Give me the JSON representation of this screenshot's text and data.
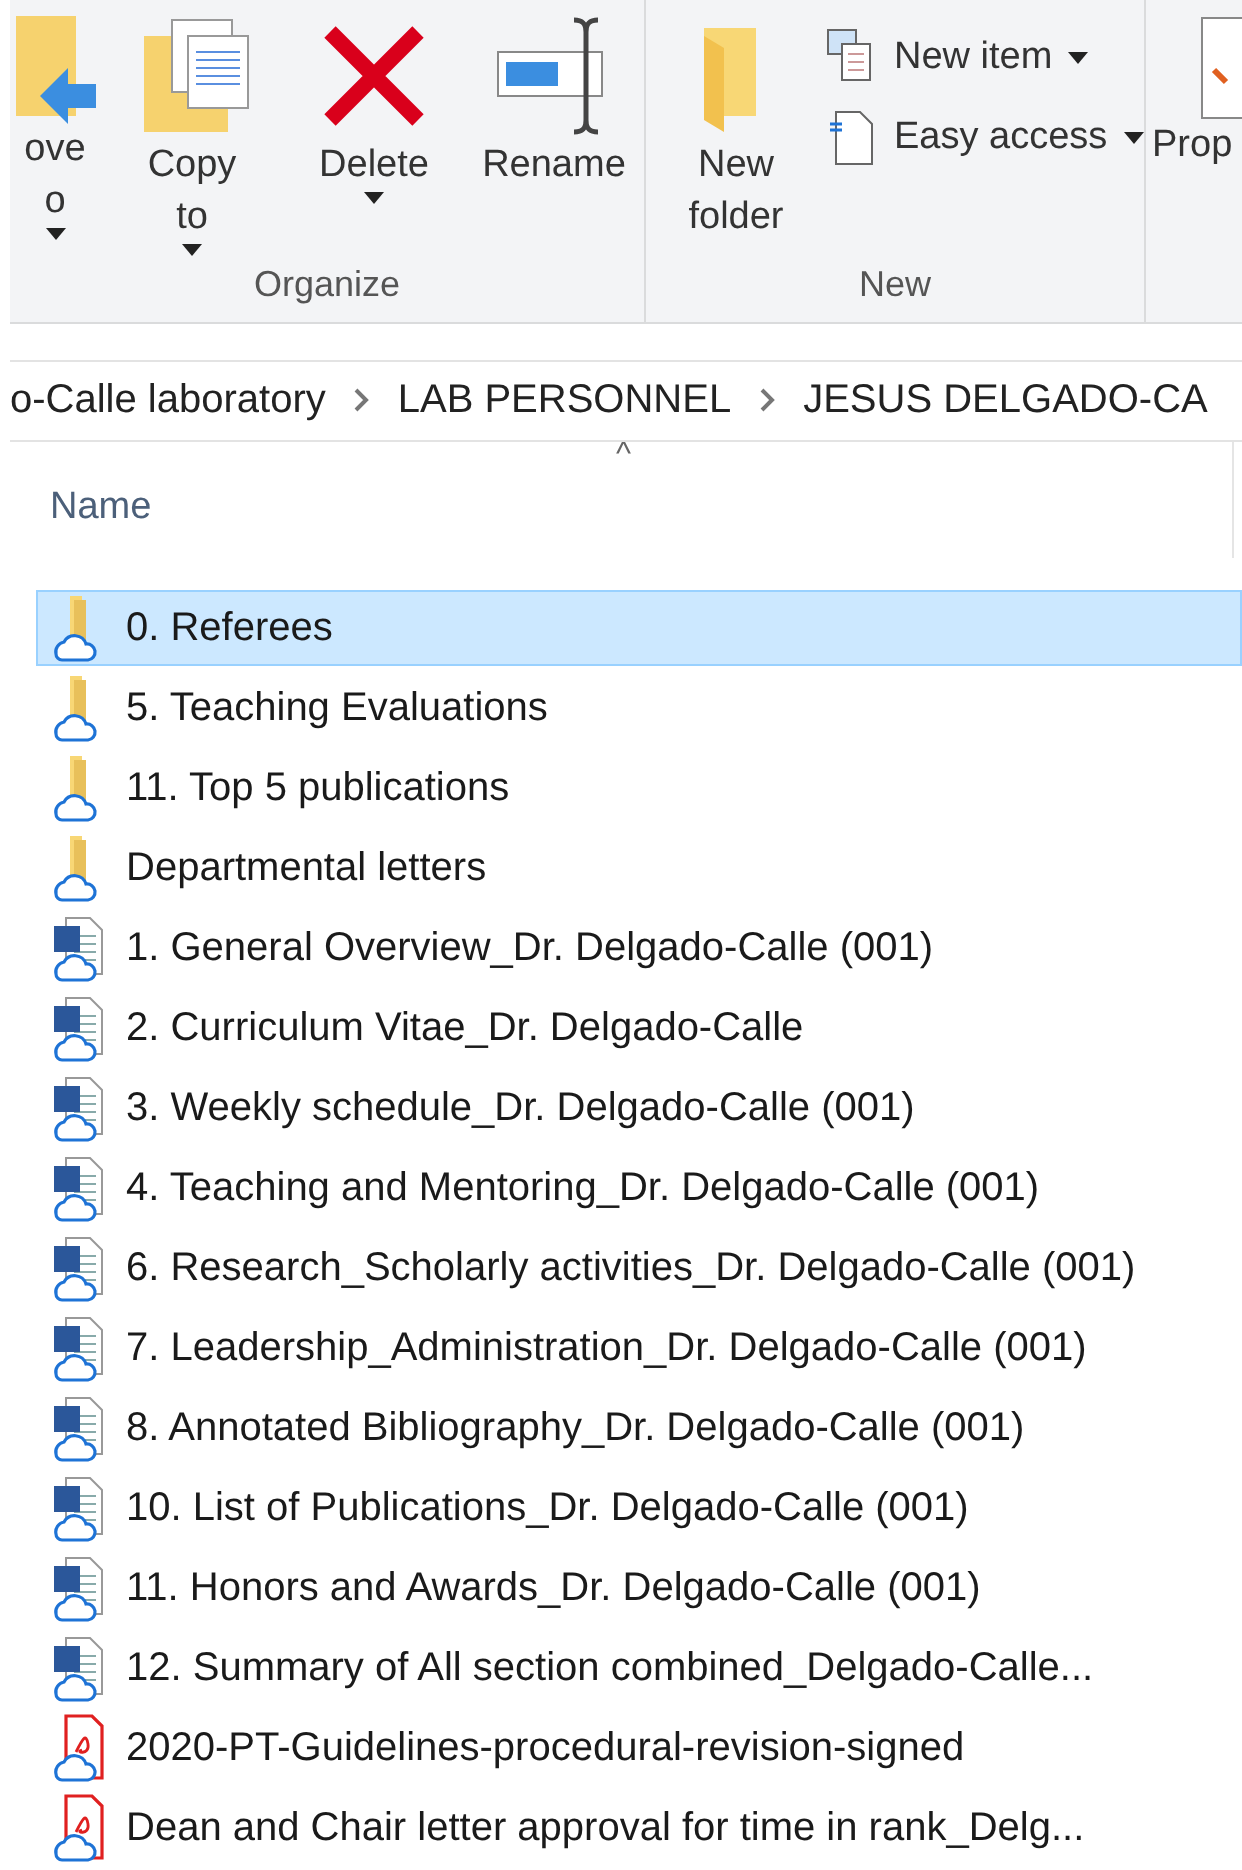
{
  "ribbon": {
    "groups": [
      {
        "label": "Organize",
        "buttons": [
          {
            "kind": "move",
            "lines": [
              "ove",
              "o"
            ],
            "caret": true
          },
          {
            "kind": "copy",
            "lines": [
              "Copy",
              "to"
            ],
            "caret": true
          },
          {
            "kind": "delete",
            "lines": [
              "Delete"
            ],
            "caret": true
          },
          {
            "kind": "rename",
            "lines": [
              "Rename"
            ],
            "caret": false
          }
        ]
      },
      {
        "label": "New",
        "buttons": [
          {
            "kind": "newfolder",
            "lines": [
              "New",
              "folder"
            ],
            "caret": false
          }
        ],
        "small": [
          {
            "kind": "newitem",
            "label": "New item",
            "caret": true
          },
          {
            "kind": "easyaccess",
            "label": "Easy access",
            "caret": true
          }
        ]
      },
      {
        "buttons": [
          {
            "kind": "properties",
            "lines": [
              "Prop"
            ],
            "caret": false
          }
        ]
      }
    ]
  },
  "breadcrumb": [
    "o-Calle laboratory",
    "LAB PERSONNEL",
    "JESUS DELGADO-CA"
  ],
  "header": {
    "name": "Name",
    "sort_glyph": "^"
  },
  "files": [
    {
      "kind": "folder",
      "name": "0. Referees",
      "selected": true
    },
    {
      "kind": "folder",
      "name": "5. Teaching Evaluations",
      "selected": false
    },
    {
      "kind": "folder",
      "name": "11. Top 5 publications",
      "selected": false
    },
    {
      "kind": "folder",
      "name": "Departmental letters",
      "selected": false
    },
    {
      "kind": "word",
      "name": "1. General Overview_Dr. Delgado-Calle (001)",
      "selected": false
    },
    {
      "kind": "word",
      "name": "2. Curriculum Vitae_Dr. Delgado-Calle",
      "selected": false
    },
    {
      "kind": "word",
      "name": "3. Weekly schedule_Dr. Delgado-Calle (001)",
      "selected": false
    },
    {
      "kind": "word",
      "name": "4. Teaching and Mentoring_Dr. Delgado-Calle (001)",
      "selected": false
    },
    {
      "kind": "word",
      "name": "6. Research_Scholarly activities_Dr. Delgado-Calle (001)",
      "selected": false
    },
    {
      "kind": "word",
      "name": "7. Leadership_Administration_Dr. Delgado-Calle (001)",
      "selected": false
    },
    {
      "kind": "word",
      "name": "8. Annotated Bibliography_Dr. Delgado-Calle (001)",
      "selected": false
    },
    {
      "kind": "word",
      "name": "10. List of Publications_Dr. Delgado-Calle (001)",
      "selected": false
    },
    {
      "kind": "word",
      "name": "11. Honors and Awards_Dr. Delgado-Calle (001)",
      "selected": false
    },
    {
      "kind": "word",
      "name": "12. Summary of All section combined_Delgado-Calle...",
      "selected": false
    },
    {
      "kind": "pdf",
      "name": "2020-PT-Guidelines-procedural-revision-signed",
      "selected": false
    },
    {
      "kind": "pdf",
      "name": "Dean and Chair letter approval for time in rank_Delg...",
      "selected": false
    }
  ]
}
